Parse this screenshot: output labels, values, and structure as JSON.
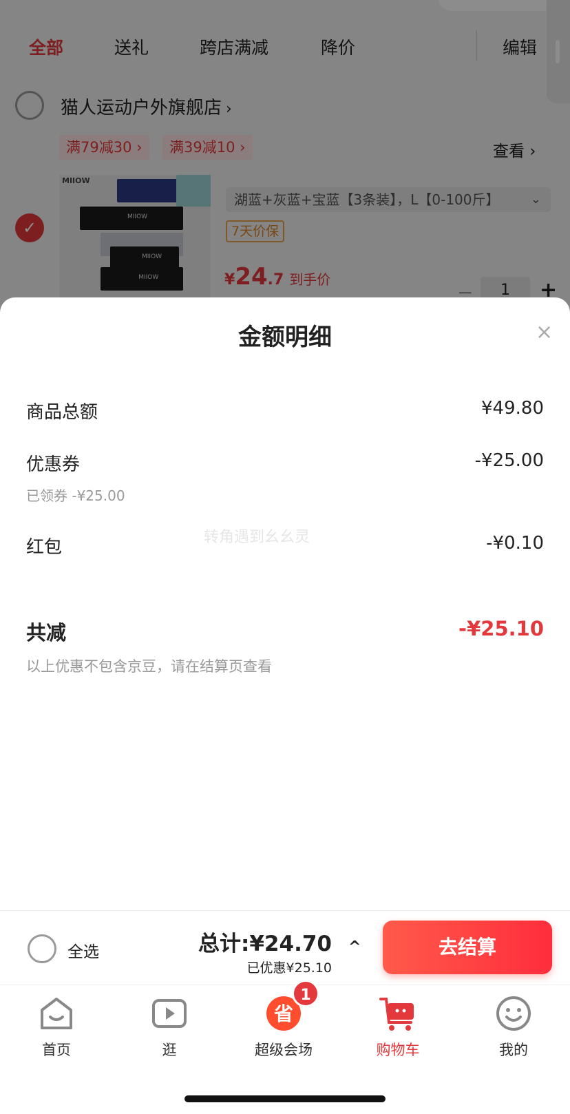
{
  "tabs": [
    "全部",
    "送礼",
    "跨店满减",
    "降价"
  ],
  "edit_label": "编辑",
  "store": {
    "name": "猫人运动户外旗舰店",
    "chevron": "›",
    "promos": [
      "满79减30 ›",
      "满39减10 ›"
    ],
    "view_label": "查看 ›"
  },
  "product": {
    "brand": "MIIOW",
    "strip_text": "MIIOW",
    "spec": "湖蓝+灰蓝+宝蓝【3条装】，L【0-100斤】",
    "spec_icon": "chevron-down-icon",
    "guarantee": "7天价保",
    "price_symbol": "¥",
    "price_int": "24",
    "price_dec": ".7",
    "price_label": "到手价",
    "quantity": "1",
    "minus": "−",
    "plus": "+"
  },
  "sheet": {
    "title": "金额明细",
    "close": "×",
    "rows": [
      {
        "label": "商品总额",
        "value": "¥49.80"
      },
      {
        "label": "优惠券",
        "value": "-¥25.00",
        "sub": "已领券 -¥25.00"
      },
      {
        "label": "红包",
        "value": "-¥0.10"
      }
    ],
    "total_label": "共减",
    "total_value": "-¥25.10",
    "note": "以上优惠不包含京豆，请在结算页查看",
    "watermark": "转角遇到幺幺灵"
  },
  "checkout": {
    "select_all": "全选",
    "total": "总计:¥24.70",
    "saved": "已优惠¥25.10",
    "caret": "^",
    "button": "去结算"
  },
  "nav": {
    "items": [
      {
        "label": "首页",
        "icon": "home-icon"
      },
      {
        "label": "逛",
        "icon": "play-icon"
      },
      {
        "label": "超级会场",
        "icon": "super-venue-icon"
      },
      {
        "label": "购物车",
        "icon": "cart-icon"
      },
      {
        "label": "我的",
        "icon": "profile-icon"
      }
    ],
    "badge": "1",
    "venue_glyph": "省"
  },
  "colors": {
    "accent": "#e4393c",
    "gold": "#d98324"
  }
}
